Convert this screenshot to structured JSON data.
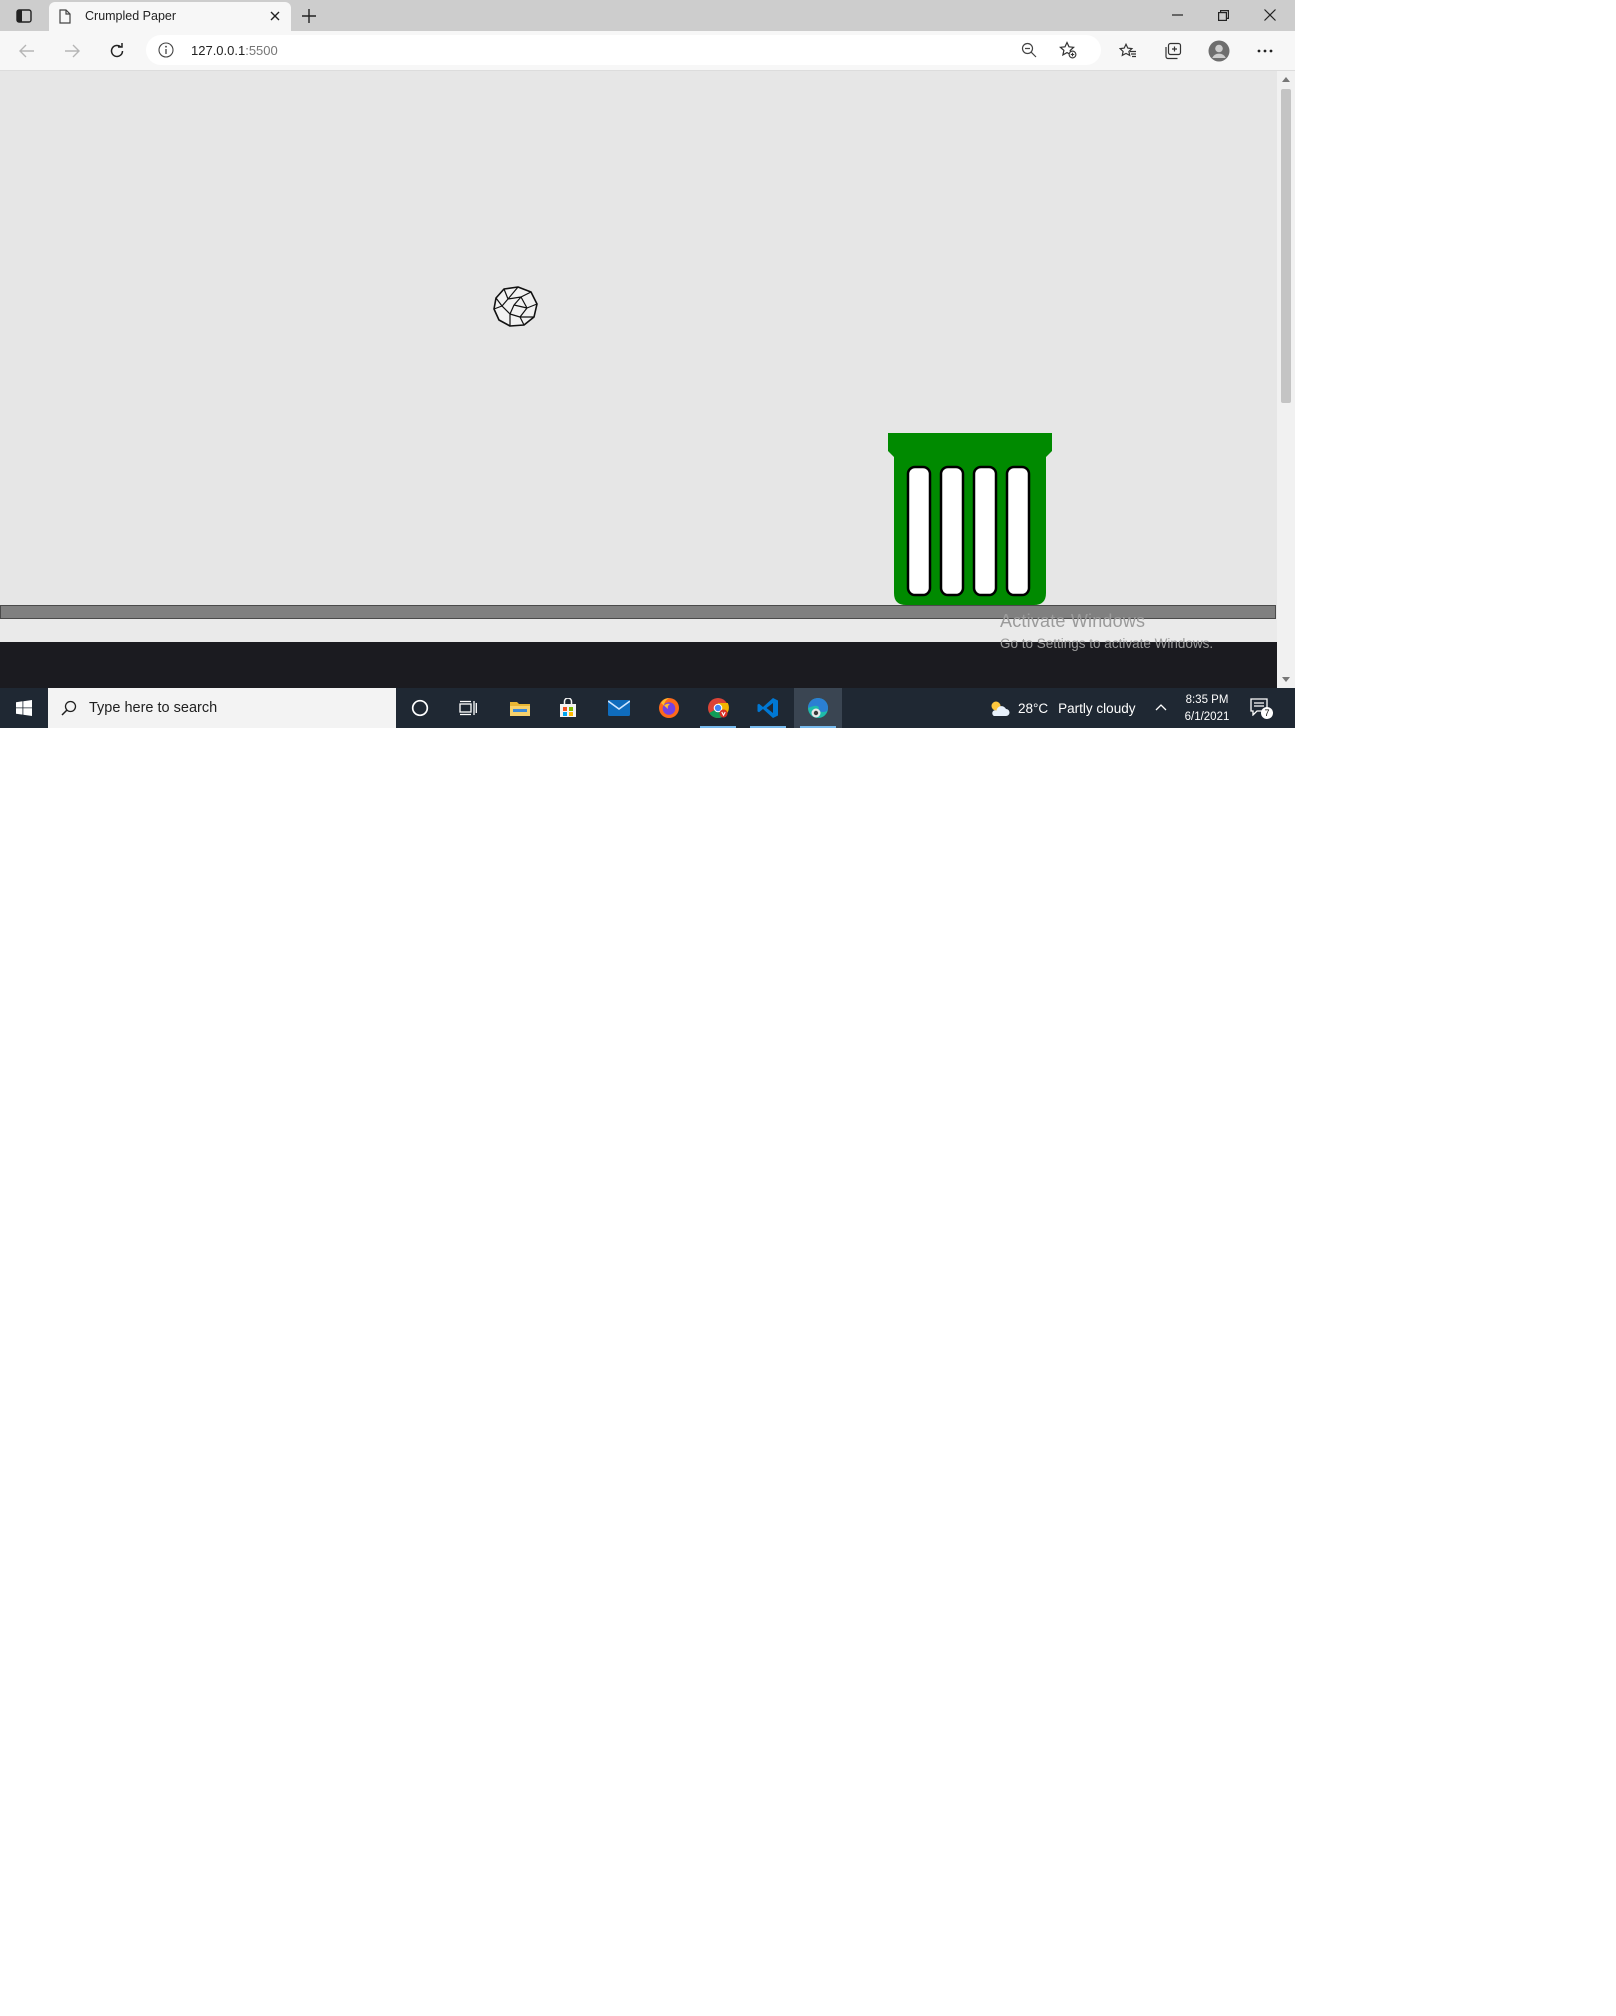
{
  "browser": {
    "tab_title": "Crumpled Paper",
    "url_host": "127.0.0.1",
    "url_port": ":5500"
  },
  "page": {
    "background": "#e6e6e6",
    "bin_color": "#008a00",
    "floor_color": "#808080"
  },
  "watermark": {
    "line1": "Activate Windows",
    "line2": "Go to Settings to activate Windows."
  },
  "taskbar": {
    "search_placeholder": "Type here to search",
    "weather_temp": "28°C",
    "weather_condition": "Partly cloudy",
    "time": "8:35 PM",
    "date": "6/1/2021",
    "notification_count": "7",
    "accent": "#76b9ed"
  },
  "icons": [
    "tab-actions-icon",
    "page-icon",
    "close-icon",
    "plus-icon",
    "minimize-icon",
    "restore-icon",
    "back-icon",
    "forward-icon",
    "refresh-icon",
    "info-icon",
    "zoom-out-icon",
    "add-favorite-icon",
    "favorites-icon",
    "collections-icon",
    "profile-icon",
    "more-icon",
    "windows-logo-icon",
    "search-icon",
    "cortana-icon",
    "task-view-icon",
    "file-explorer-icon",
    "store-icon",
    "mail-icon",
    "firefox-icon",
    "chrome-icon",
    "vscode-icon",
    "edge-icon",
    "weather-icon",
    "chevron-up-icon",
    "notification-icon"
  ]
}
